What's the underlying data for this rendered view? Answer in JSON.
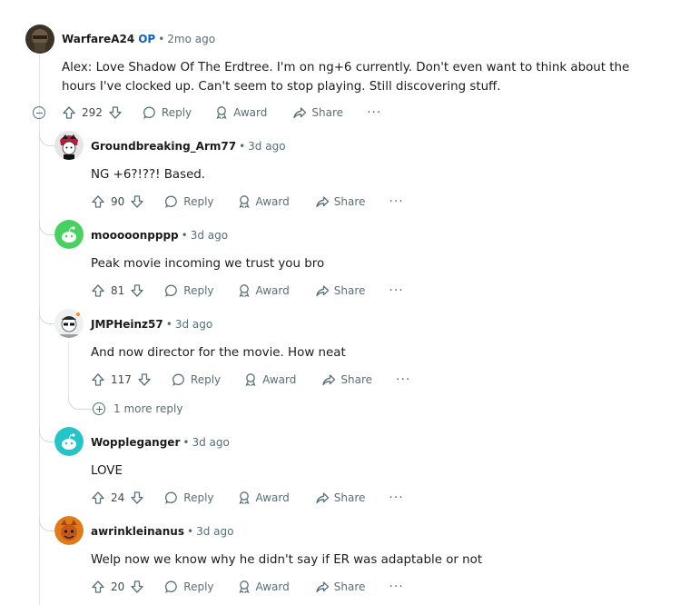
{
  "root": {
    "author": "WarfareA24",
    "op_badge": "OP",
    "time": "2mo ago",
    "text": "Alex: Love Shadow Of The Erdtree. I'm on ng+6 currently. Don't even want to think about the hours I've clocked up. Can't seem to stop playing. Still discovering stuff.",
    "votes": "292"
  },
  "labels": {
    "reply": "Reply",
    "award": "Award",
    "share": "Share",
    "more": "···",
    "sep": "•"
  },
  "replies": [
    {
      "author": "Groundbreaking_Arm77",
      "time": "3d ago",
      "text": "NG +6?!??! Based.",
      "votes": "90"
    },
    {
      "author": "mooooonpppp",
      "time": "3d ago",
      "text": "Peak movie incoming we trust you bro",
      "votes": "81"
    },
    {
      "author": "JMPHeinz57",
      "time": "3d ago",
      "text": "And now director for the movie. How neat",
      "votes": "117",
      "more_replies": "1 more reply"
    },
    {
      "author": "Woppleganger",
      "time": "3d ago",
      "text": "LOVE",
      "votes": "24"
    },
    {
      "author": "awrinkleinanus",
      "time": "3d ago",
      "text": "Welp now we know why he didn't say if ER was adaptable or not",
      "votes": "20"
    }
  ],
  "colors": {
    "accent": "#0a66c2",
    "meta": "#576f76",
    "snoo_green": "#46d160",
    "snoo_teal": "#24c4c9"
  }
}
